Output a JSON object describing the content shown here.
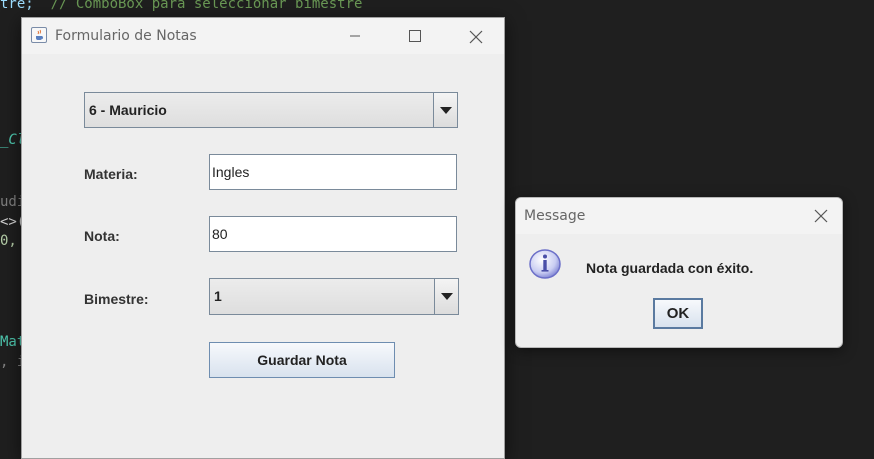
{
  "background_code": {
    "line1_code": "tre;",
    "line1_comment": "// ComboBox para seleccionar bimestre",
    "line_cl": "_Cl",
    "line_udi": "udi",
    "line_generic": "<>(",
    "line_zero": "0,",
    "line_mat": "Mat",
    "line_comma": ", i"
  },
  "main_window": {
    "title": "Formulario de Notas",
    "student_combo": {
      "selected": "6 - Mauricio"
    },
    "materia": {
      "label": "Materia:",
      "value": "Ingles"
    },
    "nota": {
      "label": "Nota:",
      "value": "80"
    },
    "bimestre": {
      "label": "Bimestre:",
      "selected": "1"
    },
    "save_button": "Guardar Nota"
  },
  "message_dialog": {
    "title": "Message",
    "text": "Nota guardada con éxito.",
    "ok_button": "OK"
  },
  "colors": {
    "editor_bg": "#1f1f1f",
    "window_bg": "#eeeeee",
    "button_border": "#6e8db0",
    "info_icon": "#6b6fc8"
  },
  "icons": {
    "app_icon": "java-icon",
    "minimize": "minimize-icon",
    "maximize": "maximize-icon",
    "close": "close-icon",
    "dropdown": "chevron-down-icon",
    "info": "info-icon"
  }
}
